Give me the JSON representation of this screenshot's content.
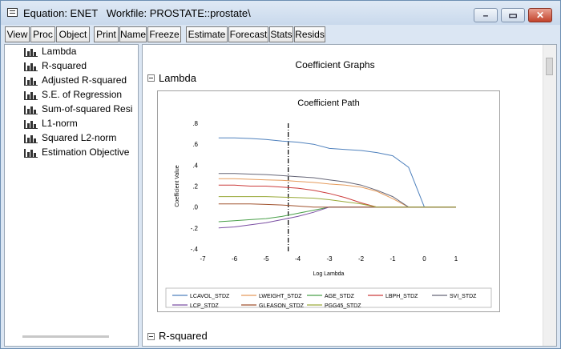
{
  "window": {
    "title_prefix": "Equation: ENET",
    "workfile": "Workfile: PROSTATE::prostate\\"
  },
  "toolbar": {
    "buttons": [
      "View",
      "Proc",
      "Object",
      "Print",
      "Name",
      "Freeze",
      "Estimate",
      "Forecast",
      "Stats",
      "Resids"
    ]
  },
  "tree": {
    "items": [
      "Lambda",
      "R-squared",
      "Adjusted R-squared",
      "S.E. of Regression",
      "Sum-of-squared Resi",
      "L1-norm",
      "Squared L2-norm",
      "Estimation Objective"
    ]
  },
  "view": {
    "heading": "Coefficient Graphs",
    "section1": "Lambda",
    "section2": "R-squared"
  },
  "chart_data": {
    "type": "line",
    "title": "Coefficient Path",
    "xlabel": "Log Lambda",
    "ylabel": "Coefficient Value",
    "xlim": [
      -7,
      1
    ],
    "ylim": [
      -0.4,
      0.8
    ],
    "xticks": [
      -7,
      -6,
      -5,
      -4,
      -3,
      -2,
      -1,
      0,
      1
    ],
    "yticks": [
      -0.4,
      -0.2,
      0.0,
      0.2,
      0.4,
      0.6,
      0.8
    ],
    "ytick_labels": [
      "-.4",
      "-.2",
      ".0",
      ".2",
      ".4",
      ".6",
      ".8"
    ],
    "vline_x": -4.3,
    "x": [
      -6.5,
      -6.0,
      -5.5,
      -5.0,
      -4.5,
      -4.0,
      -3.5,
      -3.0,
      -2.5,
      -2.0,
      -1.5,
      -1.0,
      -0.5,
      0.0,
      1.0
    ],
    "series": [
      {
        "name": "LCAVOL_STDZ",
        "color": "#4f81bd",
        "values": [
          0.66,
          0.66,
          0.655,
          0.645,
          0.63,
          0.62,
          0.6,
          0.56,
          0.55,
          0.54,
          0.52,
          0.49,
          0.38,
          0.0,
          0.0
        ]
      },
      {
        "name": "LWEIGHT_STDZ",
        "color": "#e59b5c",
        "values": [
          0.27,
          0.27,
          0.265,
          0.26,
          0.255,
          0.245,
          0.235,
          0.22,
          0.21,
          0.19,
          0.15,
          0.08,
          0.0,
          0.0,
          0.0
        ]
      },
      {
        "name": "AGE_STDZ",
        "color": "#4aa04a",
        "values": [
          -0.14,
          -0.13,
          -0.12,
          -0.11,
          -0.09,
          -0.06,
          -0.03,
          0.0,
          0.0,
          0.0,
          0.0,
          0.0,
          0.0,
          0.0,
          0.0
        ]
      },
      {
        "name": "LBPH_STDZ",
        "color": "#cc3c3c",
        "values": [
          0.21,
          0.21,
          0.2,
          0.2,
          0.19,
          0.18,
          0.16,
          0.13,
          0.09,
          0.04,
          0.0,
          0.0,
          0.0,
          0.0,
          0.0
        ]
      },
      {
        "name": "SVI_STDZ",
        "color": "#666677",
        "values": [
          0.32,
          0.32,
          0.315,
          0.31,
          0.3,
          0.29,
          0.28,
          0.26,
          0.24,
          0.21,
          0.16,
          0.1,
          0.0,
          0.0,
          0.0
        ]
      },
      {
        "name": "LCP_STDZ",
        "color": "#7b4fa3",
        "values": [
          -0.2,
          -0.19,
          -0.17,
          -0.15,
          -0.12,
          -0.09,
          -0.05,
          0.0,
          0.0,
          0.0,
          0.0,
          0.0,
          0.0,
          0.0,
          0.0
        ]
      },
      {
        "name": "GLEASON_STDZ",
        "color": "#a0522d",
        "values": [
          0.03,
          0.03,
          0.03,
          0.025,
          0.02,
          0.01,
          0.0,
          0.0,
          0.0,
          0.0,
          0.0,
          0.0,
          0.0,
          0.0,
          0.0
        ]
      },
      {
        "name": "PGG45_STDZ",
        "color": "#9aaa3a",
        "values": [
          0.1,
          0.1,
          0.1,
          0.1,
          0.095,
          0.09,
          0.085,
          0.07,
          0.05,
          0.03,
          0.0,
          0.0,
          0.0,
          0.0,
          0.0
        ]
      }
    ]
  }
}
